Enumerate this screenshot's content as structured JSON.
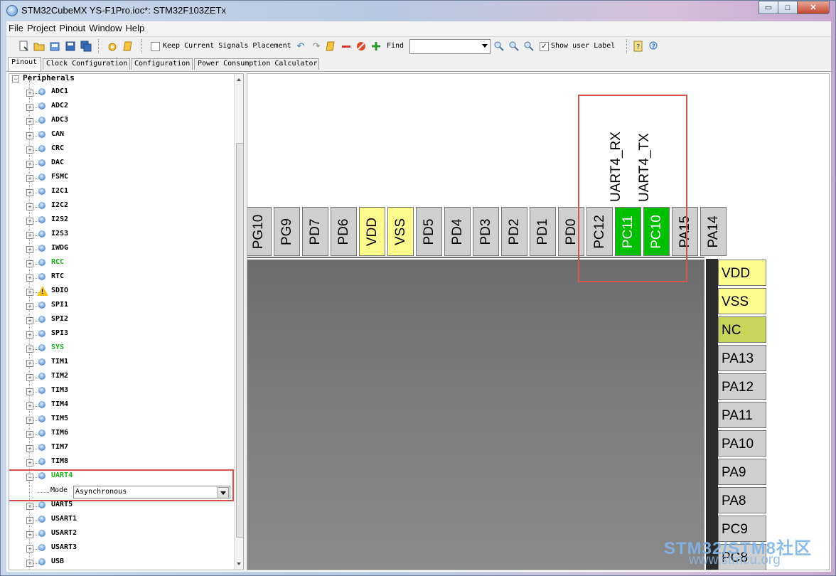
{
  "window": {
    "title": "STM32CubeMX YS-F1Pro.ioc*: STM32F103ZETx",
    "controls": {
      "minimize": "▭",
      "maximize": "□",
      "close": "✕"
    }
  },
  "menu": [
    "File",
    "Project",
    "Pinout",
    "Window",
    "Help"
  ],
  "toolbar": {
    "keep_signals_label": "Keep Current Signals Placement",
    "keep_signals_checked": false,
    "find_label": "Find",
    "find_value": "",
    "show_user_label": "Show user Label",
    "show_user_label_checked": true,
    "icons": [
      "new-project-icon",
      "open-icon",
      "open-file-icon",
      "save-icon",
      "save-as-icon",
      "generate-code-icon",
      "generate-report-icon",
      "undo-icon",
      "redo-icon",
      "clear-pinouts-icon",
      "remove-icon",
      "disable-icon",
      "add-icon",
      "zoom-in-icon",
      "zoom-out-icon",
      "zoom-fit-icon",
      "help-icon",
      "about-icon"
    ]
  },
  "tabs": [
    "Pinout",
    "Clock Configuration",
    "Configuration",
    "Power Consumption Calculator"
  ],
  "active_tab": "Pinout",
  "tree": {
    "root": "Peripherals",
    "items": [
      {
        "label": "ADC1",
        "status": "normal"
      },
      {
        "label": "ADC2",
        "status": "normal"
      },
      {
        "label": "ADC3",
        "status": "normal"
      },
      {
        "label": "CAN",
        "status": "normal"
      },
      {
        "label": "CRC",
        "status": "normal"
      },
      {
        "label": "DAC",
        "status": "normal"
      },
      {
        "label": "FSMC",
        "status": "normal"
      },
      {
        "label": "I2C1",
        "status": "normal"
      },
      {
        "label": "I2C2",
        "status": "normal"
      },
      {
        "label": "I2S2",
        "status": "normal"
      },
      {
        "label": "I2S3",
        "status": "normal"
      },
      {
        "label": "IWDG",
        "status": "normal"
      },
      {
        "label": "RCC",
        "status": "configured"
      },
      {
        "label": "RTC",
        "status": "normal"
      },
      {
        "label": "SDIO",
        "status": "warning"
      },
      {
        "label": "SPI1",
        "status": "normal"
      },
      {
        "label": "SPI2",
        "status": "normal"
      },
      {
        "label": "SPI3",
        "status": "normal"
      },
      {
        "label": "SYS",
        "status": "configured"
      },
      {
        "label": "TIM1",
        "status": "normal"
      },
      {
        "label": "TIM2",
        "status": "normal"
      },
      {
        "label": "TIM3",
        "status": "normal"
      },
      {
        "label": "TIM4",
        "status": "normal"
      },
      {
        "label": "TIM5",
        "status": "normal"
      },
      {
        "label": "TIM6",
        "status": "normal"
      },
      {
        "label": "TIM7",
        "status": "normal"
      },
      {
        "label": "TIM8",
        "status": "normal"
      },
      {
        "label": "UART4",
        "status": "configured",
        "expanded": true
      },
      {
        "label": "UART5",
        "status": "normal"
      },
      {
        "label": "USART1",
        "status": "normal"
      },
      {
        "label": "USART2",
        "status": "normal"
      },
      {
        "label": "USART3",
        "status": "normal"
      },
      {
        "label": "USB",
        "status": "normal"
      }
    ],
    "uart4_mode": {
      "label": "Mode",
      "value": "Asynchronous"
    }
  },
  "chip": {
    "top_pins": [
      {
        "name": "PG10",
        "state": "default"
      },
      {
        "name": "PG9",
        "state": "default"
      },
      {
        "name": "PD7",
        "state": "default"
      },
      {
        "name": "PD6",
        "state": "default"
      },
      {
        "name": "VDD",
        "state": "power"
      },
      {
        "name": "VSS",
        "state": "power"
      },
      {
        "name": "PD5",
        "state": "default"
      },
      {
        "name": "PD4",
        "state": "default"
      },
      {
        "name": "PD3",
        "state": "default"
      },
      {
        "name": "PD2",
        "state": "default"
      },
      {
        "name": "PD1",
        "state": "default"
      },
      {
        "name": "PD0",
        "state": "default"
      },
      {
        "name": "PC12",
        "state": "default"
      },
      {
        "name": "PC11",
        "state": "assigned",
        "signal": "UART4_RX"
      },
      {
        "name": "PC10",
        "state": "assigned",
        "signal": "UART4_TX"
      },
      {
        "name": "PA15",
        "state": "default"
      },
      {
        "name": "PA14",
        "state": "default"
      }
    ],
    "right_pins": [
      {
        "name": "VDD",
        "state": "power"
      },
      {
        "name": "VSS",
        "state": "power"
      },
      {
        "name": "NC",
        "state": "nc"
      },
      {
        "name": "PA13",
        "state": "default"
      },
      {
        "name": "PA12",
        "state": "default"
      },
      {
        "name": "PA11",
        "state": "default"
      },
      {
        "name": "PA10",
        "state": "default"
      },
      {
        "name": "PA9",
        "state": "default"
      },
      {
        "name": "PA8",
        "state": "default"
      },
      {
        "name": "PC9",
        "state": "default"
      },
      {
        "name": "PC8",
        "state": "default"
      }
    ]
  },
  "watermark": {
    "line1": "STM32/STM8社区",
    "line2": "www.stmcu.org"
  },
  "colors": {
    "assigned_pin": "#00c000",
    "power_pin": "#fdfd8e",
    "nc_pin": "#c6d55a",
    "highlight_box": "#d9534f",
    "configured_text": "#18b118"
  }
}
